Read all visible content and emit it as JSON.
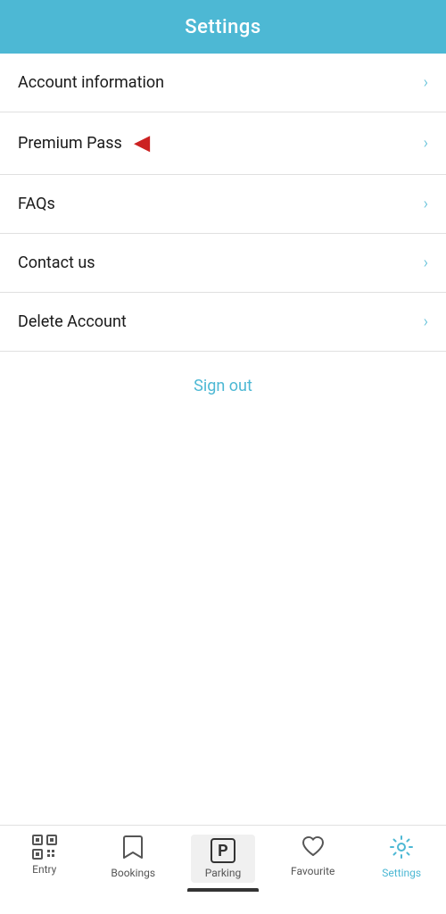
{
  "header": {
    "title": "Settings"
  },
  "menu": {
    "items": [
      {
        "id": "account-information",
        "label": "Account information",
        "hasRedArrow": false
      },
      {
        "id": "premium-pass",
        "label": "Premium Pass",
        "hasRedArrow": true
      },
      {
        "id": "faqs",
        "label": "FAQs",
        "hasRedArrow": false
      },
      {
        "id": "contact-us",
        "label": "Contact us",
        "hasRedArrow": false
      },
      {
        "id": "delete-account",
        "label": "Delete Account",
        "hasRedArrow": false
      }
    ],
    "signOut": "Sign out"
  },
  "bottomNav": {
    "items": [
      {
        "id": "entry",
        "label": "Entry",
        "icon": "qr",
        "active": false
      },
      {
        "id": "bookings",
        "label": "Bookings",
        "icon": "bookmark",
        "active": false
      },
      {
        "id": "parking",
        "label": "Parking",
        "icon": "parking",
        "active": false
      },
      {
        "id": "favourite",
        "label": "Favourite",
        "icon": "heart",
        "active": false
      },
      {
        "id": "settings",
        "label": "Settings",
        "icon": "gear",
        "active": true
      }
    ]
  },
  "colors": {
    "accent": "#4db8d4",
    "red": "#cc2222",
    "text": "#1a1a1a",
    "subtext": "#555555"
  }
}
